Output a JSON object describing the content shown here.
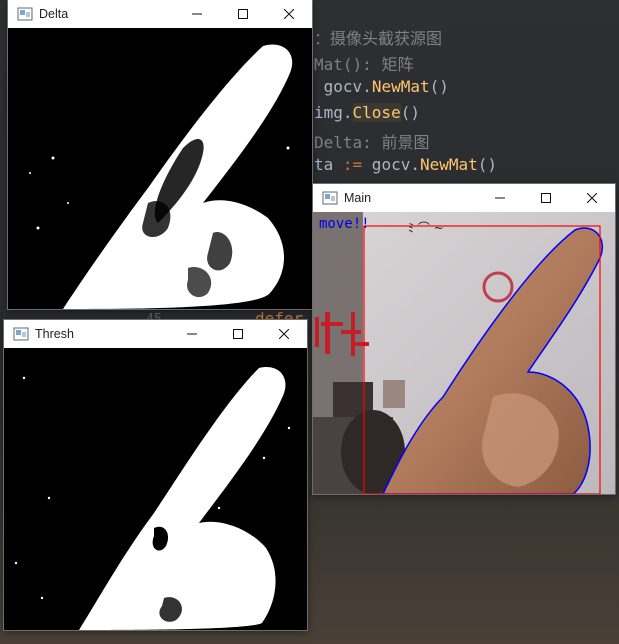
{
  "editor": {
    "lines": [
      {
        "prefix": "：",
        "comment": "摄像头截获源图"
      },
      {
        "prefix": "Mat(): ",
        "comment": "矩阵"
      },
      {
        "pre": " ",
        "pkg": "gocv.",
        "func": "NewMat",
        "post": "()"
      },
      {
        "pre": "img.",
        "hl": "Close",
        "post": "()"
      },
      {
        "prefix": "Delta: ",
        "comment": "前景图"
      },
      {
        "pre": "ta ",
        "op": ":=",
        "pkg": " gocv.",
        "func": "NewMat",
        "post": "()"
      }
    ],
    "gutter_number": "45",
    "defer_keyword": "defer"
  },
  "windows": {
    "delta": {
      "title": "Delta"
    },
    "thresh": {
      "title": "Thresh"
    },
    "main": {
      "title": "Main",
      "overlay_text": "move!!"
    }
  },
  "controls": {
    "minimize": "minimize",
    "maximize": "maximize",
    "close": "close"
  },
  "colors": {
    "bounding_box": "#ff0000",
    "contour": "#0000ff",
    "overlay_text": "#0000e6"
  }
}
